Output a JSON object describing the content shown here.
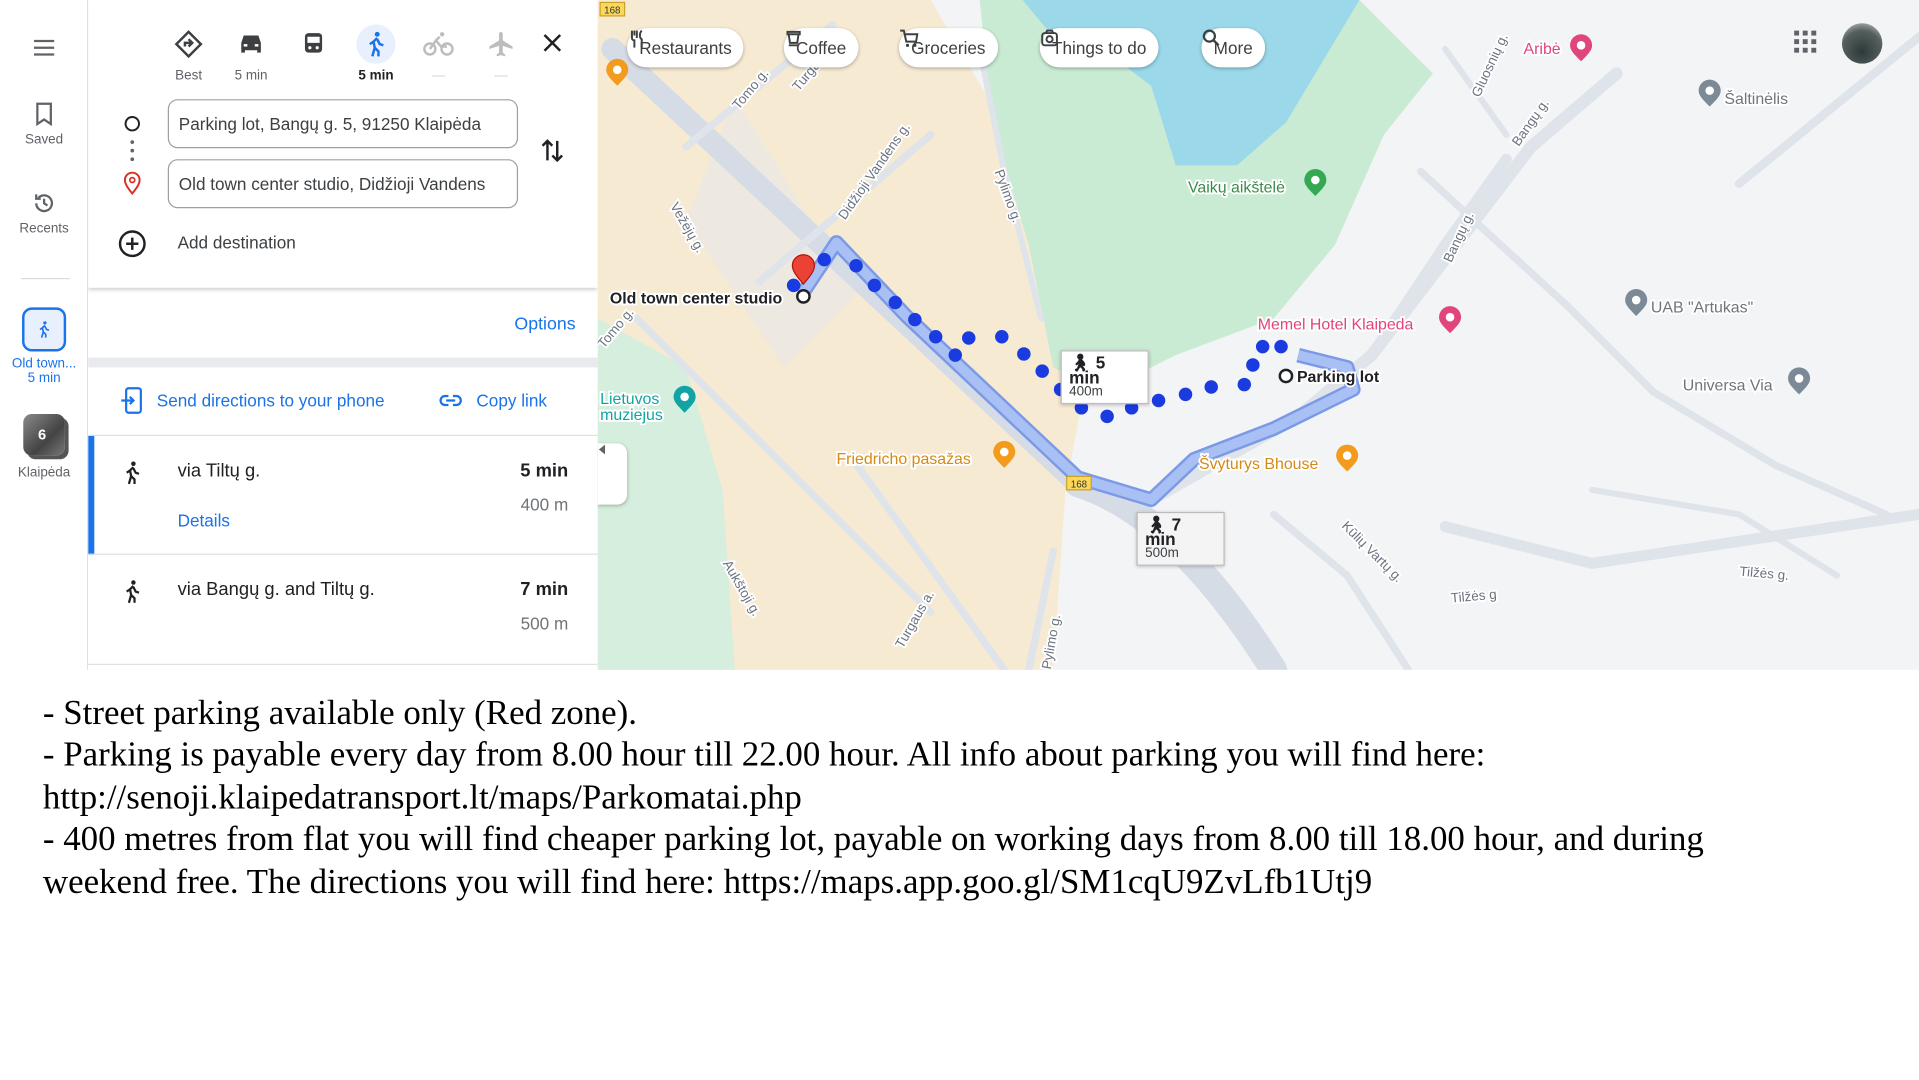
{
  "rail": {
    "saved": "Saved",
    "recents": "Recents",
    "trip_label": "Old town...",
    "trip_time": "5 min",
    "photo_count": "6",
    "photo_label": "Klaipėda"
  },
  "modes": [
    {
      "icon": "best-route-icon",
      "label": "Best"
    },
    {
      "icon": "car-icon",
      "label": "5 min"
    },
    {
      "icon": "transit-icon",
      "label": ""
    },
    {
      "icon": "walk-icon",
      "label": "5 min",
      "active": true
    },
    {
      "icon": "bike-icon",
      "label": "—"
    },
    {
      "icon": "flight-icon",
      "label": "—"
    }
  ],
  "directions": {
    "origin": "Parking lot, Bangų g. 5, 91250 Klaipėda",
    "destination": "Old town center studio, Didžioji Vandens",
    "add_destination": "Add destination",
    "options": "Options",
    "send_to_phone": "Send directions to your phone",
    "copy_link": "Copy link",
    "details": "Details"
  },
  "routes": [
    {
      "name": "via Tiltų g.",
      "time": "5 min",
      "distance": "400 m",
      "selected": true
    },
    {
      "name": "via Bangų g. and Tiltų g.",
      "time": "7 min",
      "distance": "500 m"
    }
  ],
  "chips": [
    {
      "icon": "restaurant-icon",
      "label": "Restaurants"
    },
    {
      "icon": "coffee-icon",
      "label": "Coffee"
    },
    {
      "icon": "cart-icon",
      "label": "Groceries"
    },
    {
      "icon": "camera-icon",
      "label": "Things to do"
    },
    {
      "icon": "search-icon",
      "label": "More"
    }
  ],
  "map": {
    "route_number": "168",
    "places": {
      "origin": "Parking lot",
      "destination": "Old town center studio",
      "aribe": "Aribė",
      "saltinelis": "Šaltinėlis",
      "vaiku": "Vaikų aikštelė",
      "memel": "Memel Hotel Klaipeda",
      "artukas": "UAB \"Artukas\"",
      "universa": "Universa Via",
      "lietuvos1": "Lietuvos",
      "lietuvos2": "muziejus",
      "friedricho": "Friedricho pasažas",
      "svyturys": "Švyturys Bhouse"
    },
    "streets": [
      "Bangų g.",
      "Bangų g.",
      "Gluosnių g.",
      "Tilžės g.",
      "Tilžės g",
      "Kūlių Vartų g.",
      "Pylimo g.",
      "Pylimo g.",
      "Tomo g.",
      "Tomo g.",
      "Turgaus g.",
      "Vežėjų g.",
      "Didžioji Vandens g.",
      "Aukštoji g.",
      "Turgaus a."
    ],
    "tip_main": {
      "time": "5 min",
      "distance": "400m"
    },
    "tip_alt": {
      "time": "7 min",
      "distance": "500m"
    },
    "colors": {
      "route": "#1a3be0",
      "alt_route": "#a8c0f4",
      "park": "#c9ead3",
      "water": "#9ad8ea",
      "old_town": "#f6ead3"
    }
  },
  "notes": [
    "- Street parking available only (Red zone).",
    "- Parking is payable every day from 8.00 hour till 22.00 hour. All info about parking you will find here:",
    "http://senoji.klaipedatransport.lt/maps/Parkomatai.php",
    "- 400 metres from flat you will find cheaper parking lot, payable on working days from 8.00 till 18.00 hour, and during",
    "weekend free. The directions you will find here: https://maps.app.goo.gl/SM1cqU9ZvLfb1Utj9"
  ]
}
